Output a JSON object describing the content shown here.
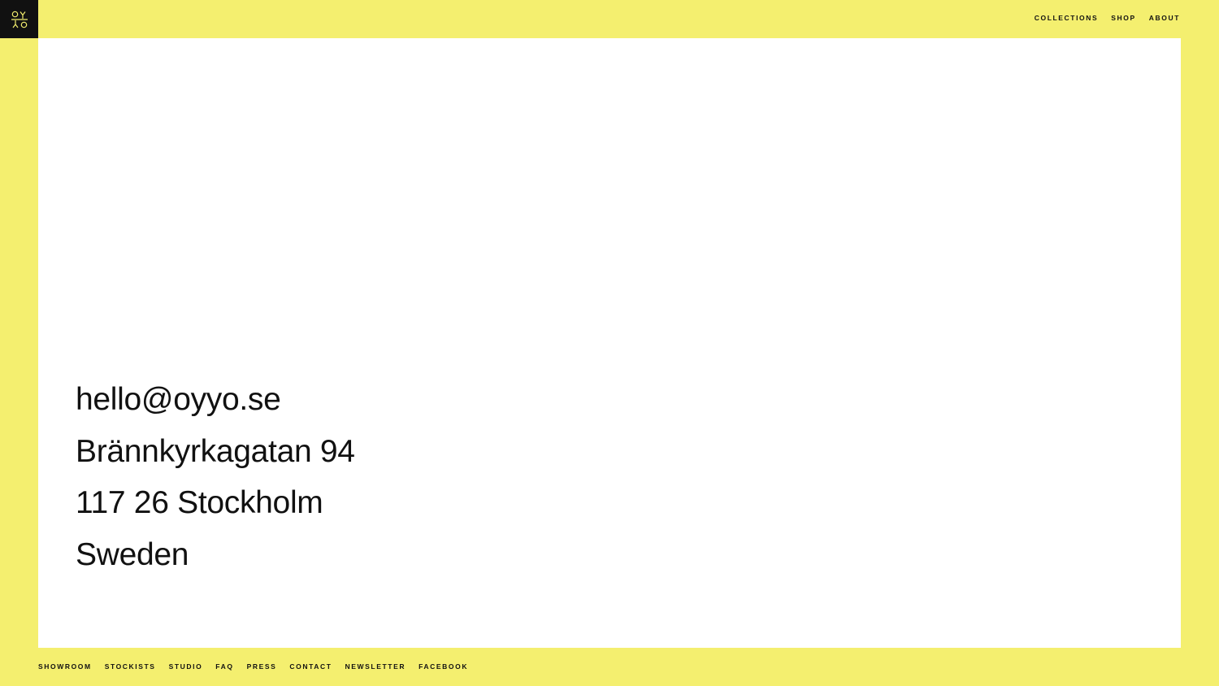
{
  "logo": {
    "name": "oyyo-logo-icon",
    "text": "OYYO"
  },
  "top_nav": {
    "items": [
      {
        "label": "COLLECTIONS"
      },
      {
        "label": "SHOP"
      },
      {
        "label": "ABOUT"
      }
    ]
  },
  "contact": {
    "email": "hello@oyyo.se",
    "street": "Brännkyrkagatan 94",
    "city": "117 26 Stockholm",
    "country": "Sweden"
  },
  "footer_nav": {
    "items": [
      {
        "label": "SHOWROOM"
      },
      {
        "label": "STOCKISTS"
      },
      {
        "label": "STUDIO"
      },
      {
        "label": "FAQ"
      },
      {
        "label": "PRESS"
      },
      {
        "label": "CONTACT"
      },
      {
        "label": "NEWSLETTER"
      },
      {
        "label": "FACEBOOK"
      }
    ]
  },
  "colors": {
    "background": "#f4ef6f",
    "panel": "#ffffff",
    "logo_bg": "#111111",
    "logo_fg": "#f4ef6f",
    "text": "#111111"
  }
}
